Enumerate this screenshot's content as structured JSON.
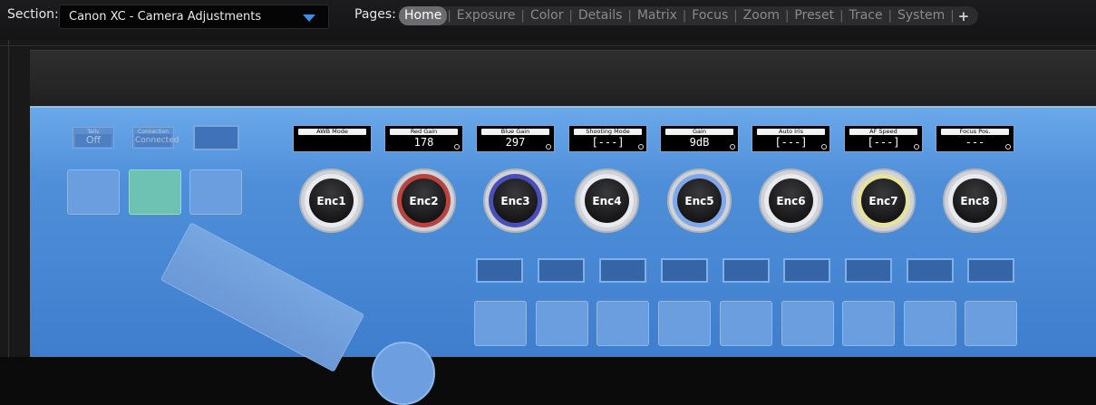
{
  "topbar": {
    "section_label": "Section:",
    "section_value": "Canon XC - Camera Adjustments",
    "pages_label": "Pages:",
    "pages": [
      "Home",
      "Exposure",
      "Color",
      "Details",
      "Matrix",
      "Focus",
      "Zoom",
      "Preset",
      "Trace",
      "System"
    ],
    "active_page": "Home",
    "add_label": "+"
  },
  "panel": {
    "mini": [
      {
        "title": "Tally",
        "value": "Off"
      },
      {
        "title": "Connection",
        "value": "Connected"
      }
    ],
    "displays": [
      {
        "label": "AWB Mode",
        "value": ""
      },
      {
        "label": "Red Gain",
        "value": "178"
      },
      {
        "label": "Blue Gain",
        "value": "297"
      },
      {
        "label": "Shooting Mode",
        "value": "[---]"
      },
      {
        "label": "Gain",
        "value": "9dB"
      },
      {
        "label": "Auto Iris",
        "value": "[---]"
      },
      {
        "label": "AF Speed",
        "value": "[---]"
      },
      {
        "label": "Focus Pos.",
        "value": "---"
      }
    ],
    "encoders": [
      {
        "label": "Enc1",
        "ring_color": "#e8eaee"
      },
      {
        "label": "Enc2",
        "ring_color": "#b8433f"
      },
      {
        "label": "Enc3",
        "ring_color": "#4a4fb8"
      },
      {
        "label": "Enc4",
        "ring_color": "#e8eaee"
      },
      {
        "label": "Enc5",
        "ring_color": "#7fa8e8"
      },
      {
        "label": "Enc6",
        "ring_color": "#e8eaee"
      },
      {
        "label": "Enc7",
        "ring_color": "#e6e3a2"
      },
      {
        "label": "Enc8",
        "ring_color": "#e8eaee"
      }
    ],
    "colors": {
      "panel": "#4f8fd9",
      "green_button": "#6dc2b4",
      "accent": "#3f8fe0"
    }
  }
}
